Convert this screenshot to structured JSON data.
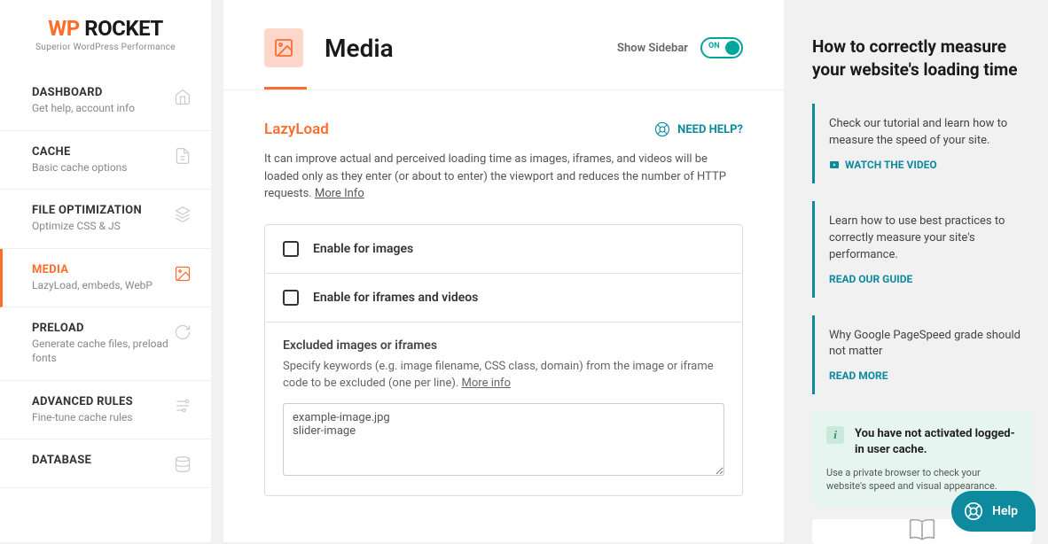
{
  "logo": {
    "wp": "WP",
    "rocket": "ROCKET",
    "tagline": "Superior WordPress Performance"
  },
  "nav": [
    {
      "title": "DASHBOARD",
      "desc": "Get help, account info"
    },
    {
      "title": "CACHE",
      "desc": "Basic cache options"
    },
    {
      "title": "FILE OPTIMIZATION",
      "desc": "Optimize CSS & JS"
    },
    {
      "title": "MEDIA",
      "desc": "LazyLoad, embeds, WebP"
    },
    {
      "title": "PRELOAD",
      "desc": "Generate cache files, preload fonts"
    },
    {
      "title": "ADVANCED RULES",
      "desc": "Fine-tune cache rules"
    },
    {
      "title": "DATABASE",
      "desc": ""
    }
  ],
  "header": {
    "title": "Media",
    "sidebar_label": "Show Sidebar",
    "toggle_state": "ON"
  },
  "section": {
    "title": "LazyLoad",
    "help_label": "NEED HELP?",
    "desc": "It can improve actual and perceived loading time as images, iframes, and videos will be loaded only as they enter (or about to enter) the viewport and reduces the number of HTTP requests.",
    "more_info": "More Info",
    "opt_images": "Enable for images",
    "opt_iframes": "Enable for iframes and videos",
    "excluded_title": "Excluded images or iframes",
    "excluded_desc": "Specify keywords (e.g. image filename, CSS class, domain) from the image or iframe code to be excluded (one per line). ",
    "excluded_more": "More info",
    "excluded_value": "example-image.jpg\nslider-image"
  },
  "right": {
    "title": "How to correctly measure your website's loading time",
    "tips": [
      {
        "text": "Check our tutorial and learn how to measure the speed of your site.",
        "link": "WATCH THE VIDEO",
        "video": true
      },
      {
        "text": "Learn how to use best practices to correctly measure your site's performance.",
        "link": "READ OUR GUIDE",
        "video": false
      },
      {
        "text": "Why Google PageSpeed grade should not matter",
        "link": "READ MORE",
        "video": false
      }
    ],
    "notice_title": "You have not activated logged-in user cache.",
    "notice_sub": "Use a private browser to check your website's speed and visual appearance."
  },
  "fab": {
    "label": "Help"
  }
}
